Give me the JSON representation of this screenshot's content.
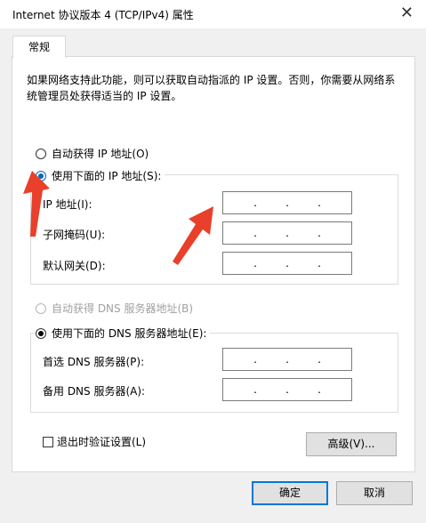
{
  "window": {
    "title": "Internet 协议版本 4 (TCP/IPv4) 属性",
    "close_glyph": "✕"
  },
  "tabs": [
    {
      "label": "常规"
    }
  ],
  "description": "如果网络支持此功能，则可以获取自动指派的 IP 设置。否则，你需要从网络系统管理员处获得适当的 IP 设置。",
  "ip": {
    "auto_label": "自动获得 IP 地址(O)",
    "manual_label": "使用下面的 IP 地址(S):",
    "selected": "manual",
    "fields": [
      {
        "label": "IP 地址(I):",
        "value": ". . ."
      },
      {
        "label": "子网掩码(U):",
        "value": ". . ."
      },
      {
        "label": "默认网关(D):",
        "value": ". . ."
      }
    ]
  },
  "dns": {
    "auto_label": "自动获得 DNS 服务器地址(B)",
    "manual_label": "使用下面的 DNS 服务器地址(E):",
    "selected": "manual",
    "auto_disabled": true,
    "fields": [
      {
        "label": "首选 DNS 服务器(P):",
        "value": ". . ."
      },
      {
        "label": "备用 DNS 服务器(A):",
        "value": ". . ."
      }
    ]
  },
  "validate_on_exit": {
    "label": "退出时验证设置(L)",
    "checked": false
  },
  "buttons": {
    "advanced": "高级(V)...",
    "ok": "确定",
    "cancel": "取消"
  },
  "annotation_color": "#e8402a"
}
